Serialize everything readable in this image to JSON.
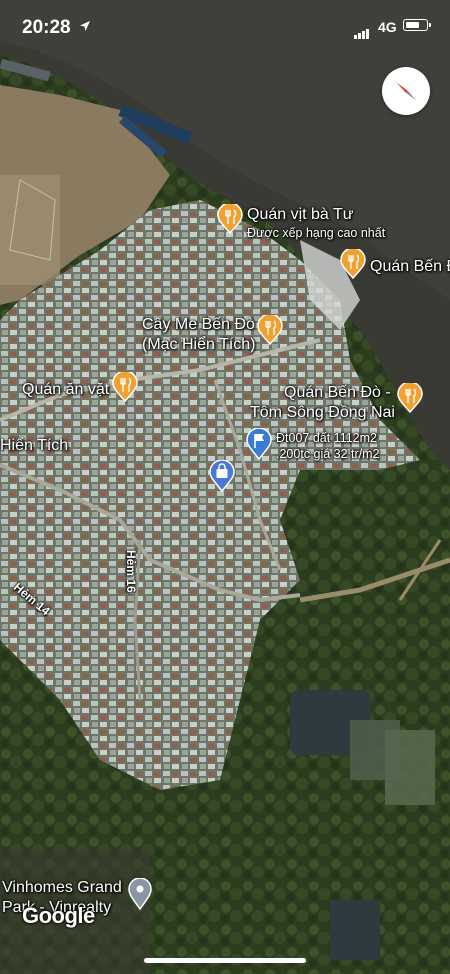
{
  "status_bar": {
    "time": "20:28",
    "network": "4G",
    "location_icon": "location-arrow-icon",
    "signal_icon": "cellular-signal-icon",
    "battery_icon": "battery-icon"
  },
  "map": {
    "type": "satellite",
    "compass_icon": "compass-icon",
    "places": [
      {
        "name": "Quán vịt bà Tư",
        "subtitle": "Được xếp hạng cao nhất",
        "icon": "restaurant-icon"
      },
      {
        "name": "Quán Bến Đ",
        "icon": "restaurant-icon"
      },
      {
        "name_line1": "Cây Me Bến Đò",
        "name_line2": "(Mạc Hiển Tích)",
        "icon": "restaurant-icon"
      },
      {
        "name": "Quán ăn vặt",
        "icon": "restaurant-icon"
      },
      {
        "name_line1": "Quán Bến Đò -",
        "name_line2": "Tôm Sông Đồng Nai",
        "icon": "restaurant-icon"
      },
      {
        "name_line1": "Đt007 đất 1112m2",
        "name_line2": ".200tc giá 32 tr/m2",
        "icon": "flag-icon"
      },
      {
        "name": "",
        "icon": "shopping-bag-icon"
      },
      {
        "name_line1": "Vinhomes Grand",
        "name_line2": "Park - Vinrealty",
        "icon": "location-pin-icon"
      }
    ],
    "roads": [
      "Hiển Tích",
      "Hẻm 14",
      "Hẻm 16"
    ],
    "attribution": "Google"
  }
}
